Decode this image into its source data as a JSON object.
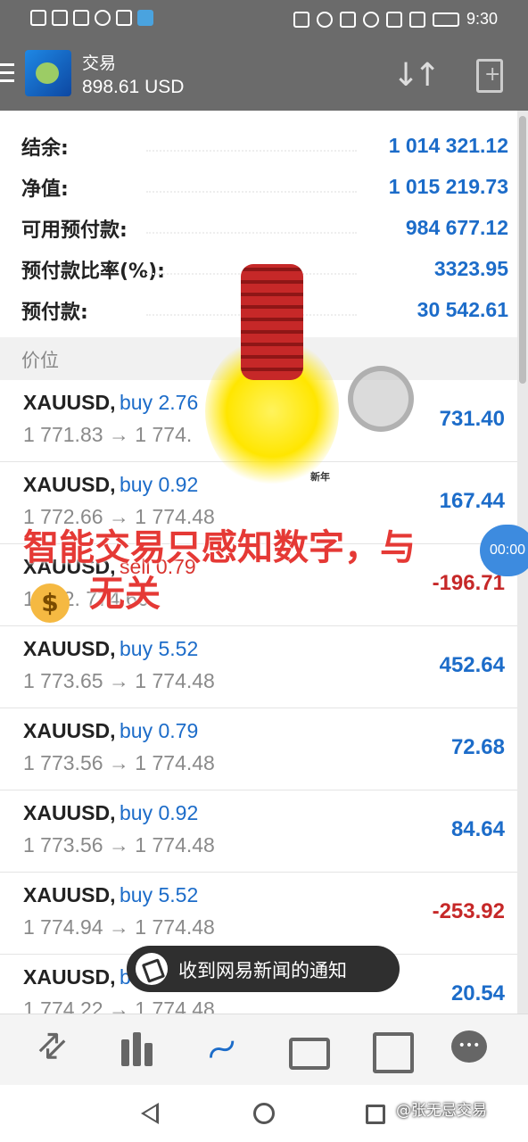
{
  "status_bar": {
    "left_icons": [
      "network-icon",
      "signal-icon",
      "signal-icon",
      "wifi-icon",
      "sim-icon",
      "app-notification-icon"
    ],
    "right_icons": [
      "nfc-icon",
      "alarm-icon",
      "bluetooth-icon",
      "mic-icon",
      "mute-icon",
      "vibrate-icon",
      "battery-icon"
    ],
    "time": "9:30"
  },
  "app_bar": {
    "title": "交易",
    "balance": "898.61 USD"
  },
  "summary": {
    "rows": [
      {
        "label": "结余:",
        "value": "1 014 321.12"
      },
      {
        "label": "净值:",
        "value": "1 015 219.73"
      },
      {
        "label": "可用预付款:",
        "value": "984 677.12"
      },
      {
        "label": "预付款比率(%):",
        "value": "3323.95"
      },
      {
        "label": "预付款:",
        "value": "30 542.61"
      }
    ]
  },
  "section_header": "价位",
  "positions": [
    {
      "symbol": "XAUUSD,",
      "side": "buy 2.76",
      "prices": "1 771.83 → 1 774.",
      "profit": "731.40",
      "negative": false
    },
    {
      "symbol": "XAUUSD,",
      "side": "buy 0.92",
      "prices": "1 772.66 → 1 774.48",
      "profit": "167.44",
      "negative": false
    },
    {
      "symbol": "XAUUSD,",
      "side": "sell 0.79",
      "prices": "1 772.    774.66",
      "profit": "-196.71",
      "negative": true
    },
    {
      "symbol": "XAUUSD,",
      "side": "buy 5.52",
      "prices": "1 773.65 → 1 774.48",
      "profit": "452.64",
      "negative": false
    },
    {
      "symbol": "XAUUSD,",
      "side": "buy 0.79",
      "prices": "1 773.56 → 1 774.48",
      "profit": "72.68",
      "negative": false
    },
    {
      "symbol": "XAUUSD,",
      "side": "buy 0.92",
      "prices": "1 773.56 → 1 774.48",
      "profit": "84.64",
      "negative": false
    },
    {
      "symbol": "XAUUSD,",
      "side": "buy 5.52",
      "prices": "1 774.94 → 1 774.48",
      "profit": "-253.92",
      "negative": true
    },
    {
      "symbol": "XAUUSD,",
      "side": "b",
      "prices": "1 774.22 → 1 774.48",
      "profit": "20.54",
      "negative": false
    }
  ],
  "overlay": {
    "caption_line1": "智能交易只感知数字，与",
    "caption_line2": "无关",
    "money_bag_symbol": "$",
    "sticker_badge": "新年",
    "timer": "00:00"
  },
  "toast": {
    "text": "收到网易新闻的通知"
  },
  "bottom_nav": [
    "quotes-icon",
    "chart-icon",
    "trade-icon",
    "history-icon",
    "news-icon",
    "chat-icon"
  ],
  "watermark": "@张无忌交易",
  "colors": {
    "header_bg": "#6b6b6b",
    "value_blue": "#1c6cc9",
    "loss_red": "#c62828",
    "caption_red": "#e53935"
  }
}
